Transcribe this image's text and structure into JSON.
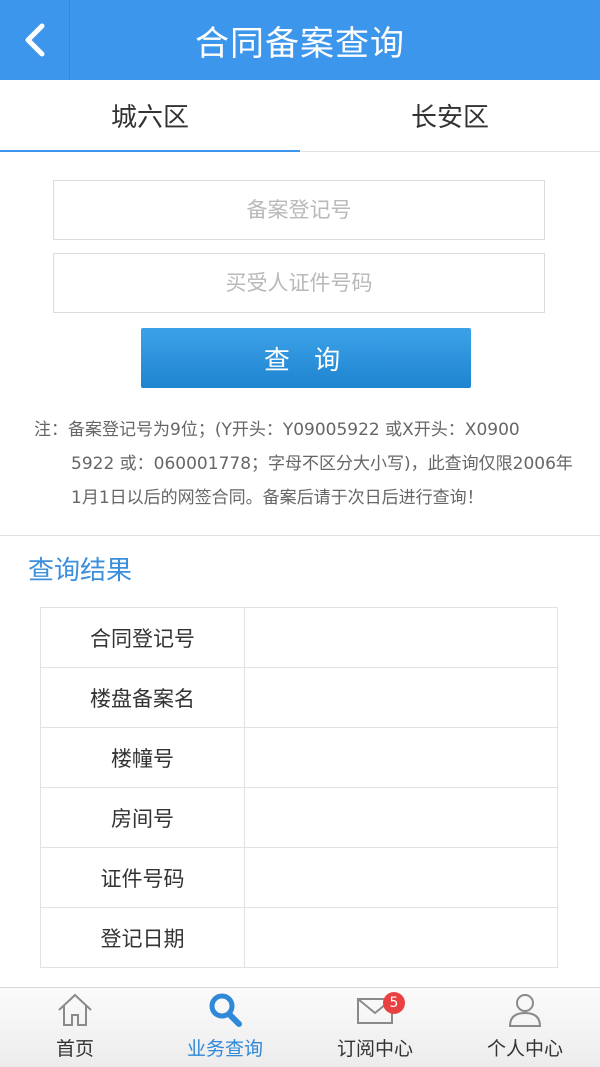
{
  "header": {
    "title": "合同备案查询"
  },
  "tabs": [
    {
      "label": "城六区",
      "active": true
    },
    {
      "label": "长安区",
      "active": false
    }
  ],
  "form": {
    "record_no_placeholder": "备案登记号",
    "id_no_placeholder": "买受人证件号码",
    "query_label": "查 询"
  },
  "note": {
    "lead": "注：备案登记号为9位；(Y开头：Y09005922 或X开头：X0900",
    "rest": "5922 或：060001778；字母不区分大小写)，此查询仅限2006年1月1日以后的网签合同。备案后请于次日后进行查询！"
  },
  "results": {
    "title": "查询结果",
    "rows": [
      {
        "label": "合同登记号",
        "value": ""
      },
      {
        "label": "楼盘备案名",
        "value": ""
      },
      {
        "label": "楼幢号",
        "value": ""
      },
      {
        "label": "房间号",
        "value": ""
      },
      {
        "label": "证件号码",
        "value": ""
      },
      {
        "label": "登记日期",
        "value": ""
      }
    ]
  },
  "bottom_nav": {
    "items": [
      {
        "label": "首页",
        "icon": "home-icon",
        "active": false
      },
      {
        "label": "业务查询",
        "icon": "search-icon",
        "active": true
      },
      {
        "label": "订阅中心",
        "icon": "mail-icon",
        "active": false,
        "badge": "5"
      },
      {
        "label": "个人中心",
        "icon": "user-icon",
        "active": false
      }
    ]
  },
  "colors": {
    "primary": "#3c96ec",
    "button": "#2a8fdc",
    "badge": "#e94141",
    "result_title": "#3c8fdc"
  }
}
